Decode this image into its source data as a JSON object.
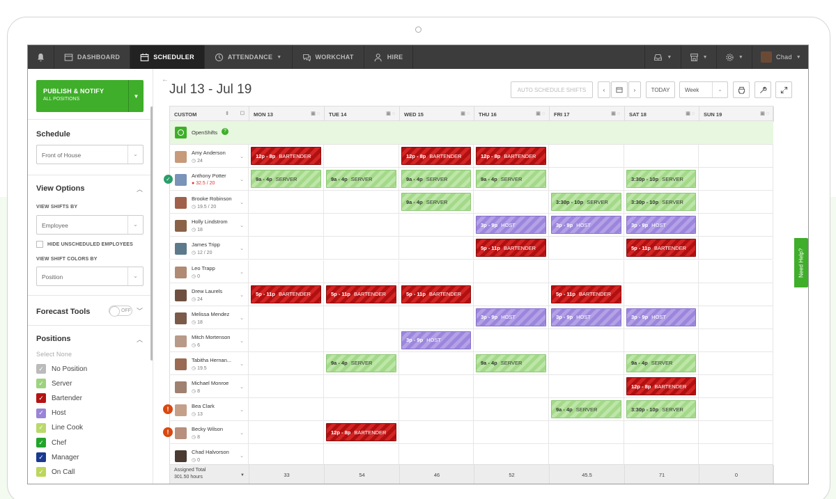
{
  "nav": {
    "items": [
      {
        "label": "DASHBOARD",
        "icon": "dashboard-icon"
      },
      {
        "label": "SCHEDULER",
        "icon": "calendar-icon"
      },
      {
        "label": "ATTENDANCE",
        "icon": "clock-icon"
      },
      {
        "label": "WORKCHAT",
        "icon": "chat-icon"
      },
      {
        "label": "HIRE",
        "icon": "person-icon"
      }
    ],
    "user": "Chad"
  },
  "sidebar": {
    "publish_label": "PUBLISH & NOTIFY",
    "publish_sub": "ALL POSITIONS",
    "schedule_heading": "Schedule",
    "schedule_value": "Front of House",
    "view_options_heading": "View Options",
    "view_shifts_by_label": "VIEW SHIFTS BY",
    "view_shifts_by_value": "Employee",
    "hide_unscheduled_label": "HIDE UNSCHEDULED EMPLOYEES",
    "view_colors_label": "VIEW SHIFT COLORS BY",
    "view_colors_value": "Position",
    "forecast_label": "Forecast Tools",
    "forecast_toggle": "OFF",
    "positions_heading": "Positions",
    "select_none": "Select None",
    "positions": [
      {
        "label": "No Position",
        "color": "#bbbbbb"
      },
      {
        "label": "Server",
        "color": "#9ed27e"
      },
      {
        "label": "Bartender",
        "color": "#b51414"
      },
      {
        "label": "Host",
        "color": "#9a84d8"
      },
      {
        "label": "Line Cook",
        "color": "#b9d96b"
      },
      {
        "label": "Chef",
        "color": "#22a52a"
      },
      {
        "label": "Manager",
        "color": "#1a3a8f"
      },
      {
        "label": "On Call",
        "color": "#bcd65a"
      }
    ]
  },
  "header": {
    "date_range": "Jul 13 - Jul 19",
    "auto_schedule": "AUTO SCHEDULE SHIFTS",
    "today": "TODAY",
    "view_mode": "Week"
  },
  "grid": {
    "sort_label": "CUSTOM",
    "days": [
      "MON 13",
      "TUE 14",
      "WED 15",
      "THU 16",
      "FRI 17",
      "SAT 18",
      "SUN 19"
    ],
    "openshifts_label": "OpenShifts",
    "employees": [
      {
        "name": "Amy Anderson",
        "hours": "24",
        "avatar": "#c79a7a",
        "shifts": [
          {
            "day": 0,
            "time": "12p - 8p",
            "role": "BARTENDER"
          },
          {
            "day": 2,
            "time": "12p - 8p",
            "role": "BARTENDER"
          },
          {
            "day": 3,
            "time": "12p - 8p",
            "role": "BARTENDER"
          }
        ]
      },
      {
        "name": "Anthony Potter",
        "hours": "32.5 / 20",
        "over": true,
        "status": "check",
        "avatar": "#7a93b8",
        "shifts": [
          {
            "day": 0,
            "time": "9a - 4p",
            "role": "SERVER"
          },
          {
            "day": 1,
            "time": "9a - 4p",
            "role": "SERVER"
          },
          {
            "day": 2,
            "time": "9a - 4p",
            "role": "SERVER"
          },
          {
            "day": 3,
            "time": "9a - 4p",
            "role": "SERVER"
          },
          {
            "day": 5,
            "time": "3:30p - 10p",
            "role": "SERVER"
          }
        ]
      },
      {
        "name": "Brooke Robinson",
        "hours": "19.5 / 20",
        "avatar": "#a0604a",
        "shifts": [
          {
            "day": 2,
            "time": "9a - 4p",
            "role": "SERVER"
          },
          {
            "day": 4,
            "time": "3:30p - 10p",
            "role": "SERVER"
          },
          {
            "day": 5,
            "time": "3:30p - 10p",
            "role": "SERVER"
          }
        ]
      },
      {
        "name": "Holly Lindstrom",
        "hours": "18",
        "avatar": "#8a6248",
        "shifts": [
          {
            "day": 3,
            "time": "3p - 9p",
            "role": "HOST"
          },
          {
            "day": 4,
            "time": "3p - 9p",
            "role": "HOST"
          },
          {
            "day": 5,
            "time": "3p - 9p",
            "role": "HOST"
          }
        ]
      },
      {
        "name": "James Tripp",
        "hours": "12 / 20",
        "avatar": "#5c7a8c",
        "shifts": [
          {
            "day": 3,
            "time": "5p - 11p",
            "role": "BARTENDER"
          },
          {
            "day": 5,
            "time": "5p - 11p",
            "role": "BARTENDER"
          }
        ]
      },
      {
        "name": "Leo Trapp",
        "hours": "0",
        "avatar": "#b08a72",
        "shifts": []
      },
      {
        "name": "Drew Laurels",
        "hours": "24",
        "avatar": "#6f5040",
        "shifts": [
          {
            "day": 0,
            "time": "5p - 11p",
            "role": "BARTENDER"
          },
          {
            "day": 1,
            "time": "5p - 11p",
            "role": "BARTENDER"
          },
          {
            "day": 2,
            "time": "5p - 11p",
            "role": "BARTENDER"
          },
          {
            "day": 4,
            "time": "5p - 11p",
            "role": "BARTENDER"
          }
        ]
      },
      {
        "name": "Melissa Mendez",
        "hours": "18",
        "avatar": "#7b5a4a",
        "shifts": [
          {
            "day": 3,
            "time": "3p - 9p",
            "role": "HOST"
          },
          {
            "day": 4,
            "time": "3p - 9p",
            "role": "HOST"
          },
          {
            "day": 5,
            "time": "3p - 9p",
            "role": "HOST"
          }
        ]
      },
      {
        "name": "Mitch Mortenson",
        "hours": "6",
        "avatar": "#b89a88",
        "shifts": [
          {
            "day": 2,
            "time": "3p - 9p",
            "role": "HOST"
          }
        ]
      },
      {
        "name": "Tabitha Hernan...",
        "hours": "19.5",
        "avatar": "#9a6a52",
        "shifts": [
          {
            "day": 1,
            "time": "9a - 4p",
            "role": "SERVER"
          },
          {
            "day": 3,
            "time": "9a - 4p",
            "role": "SERVER"
          },
          {
            "day": 5,
            "time": "9a - 4p",
            "role": "SERVER"
          }
        ]
      },
      {
        "name": "Michael Monroe",
        "hours": "8",
        "avatar": "#a08070",
        "shifts": [
          {
            "day": 5,
            "time": "12p - 8p",
            "role": "BARTENDER"
          }
        ]
      },
      {
        "name": "Bea Clark",
        "hours": "13",
        "status": "alert",
        "avatar": "#c4a08a",
        "shifts": [
          {
            "day": 4,
            "time": "9a - 4p",
            "role": "SERVER"
          },
          {
            "day": 5,
            "time": "3:30p - 10p",
            "role": "SERVER"
          }
        ]
      },
      {
        "name": "Becky Wilson",
        "hours": "8",
        "status": "alert",
        "avatar": "#b88e7c",
        "shifts": [
          {
            "day": 1,
            "time": "12p - 8p",
            "role": "BARTENDER"
          }
        ]
      },
      {
        "name": "Chad Halvorson",
        "hours": "0",
        "avatar": "#4a3a32",
        "shifts": []
      }
    ],
    "totals_label": "Assigned Total",
    "totals_hours": "301.50 hours",
    "totals": [
      "33",
      "54",
      "46",
      "52",
      "45.5",
      "71",
      "0"
    ]
  },
  "help_label": "Need Help?"
}
